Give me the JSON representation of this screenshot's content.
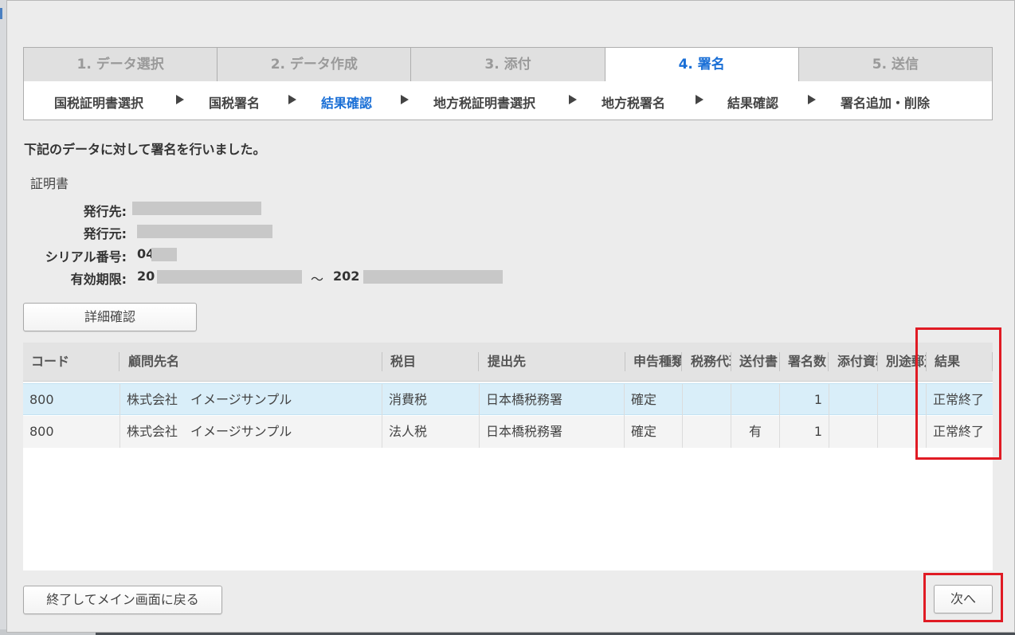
{
  "steps": [
    "1. データ選択",
    "2. データ作成",
    "3. 添付",
    "4. 署名",
    "5. 送信"
  ],
  "active_step": 3,
  "substeps": [
    "国税証明書選択",
    "国税署名",
    "結果確認",
    "地方税証明書選択",
    "地方税署名",
    "結果確認",
    "署名追加・削除"
  ],
  "active_substep": 2,
  "message": "下記のデータに対して署名を行いました。",
  "certificate": {
    "title": "証明書",
    "issued_to_label": "発行先:",
    "issued_by_label": "発行元:",
    "serial_label": "シリアル番号:",
    "serial_value": "04",
    "validity_label": "有効期限:",
    "validity_start": "20",
    "validity_separator": "～",
    "validity_end": "202"
  },
  "detail_button": "詳細確認",
  "table": {
    "columns": [
      "コード",
      "顧問先名",
      "税目",
      "提出先",
      "申告種類",
      "税務代理",
      "送付書",
      "署名数",
      "添付資料",
      "別途郵送",
      "結果"
    ],
    "rows": [
      [
        "800",
        "株式会社　イメージサンプル",
        "消費税",
        "日本橋税務署",
        "確定",
        "",
        "",
        "1",
        "",
        "",
        "正常終了"
      ],
      [
        "800",
        "株式会社　イメージサンプル",
        "法人税",
        "日本橋税務署",
        "確定",
        "",
        "有",
        "1",
        "",
        "",
        "正常終了"
      ]
    ]
  },
  "footer": {
    "exit_button": "終了してメイン画面に戻る",
    "next_button": "次へ"
  },
  "colors": {
    "accent": "#1a6fd6",
    "highlight": "#e01b24",
    "selected_row": "#d9eef9"
  }
}
